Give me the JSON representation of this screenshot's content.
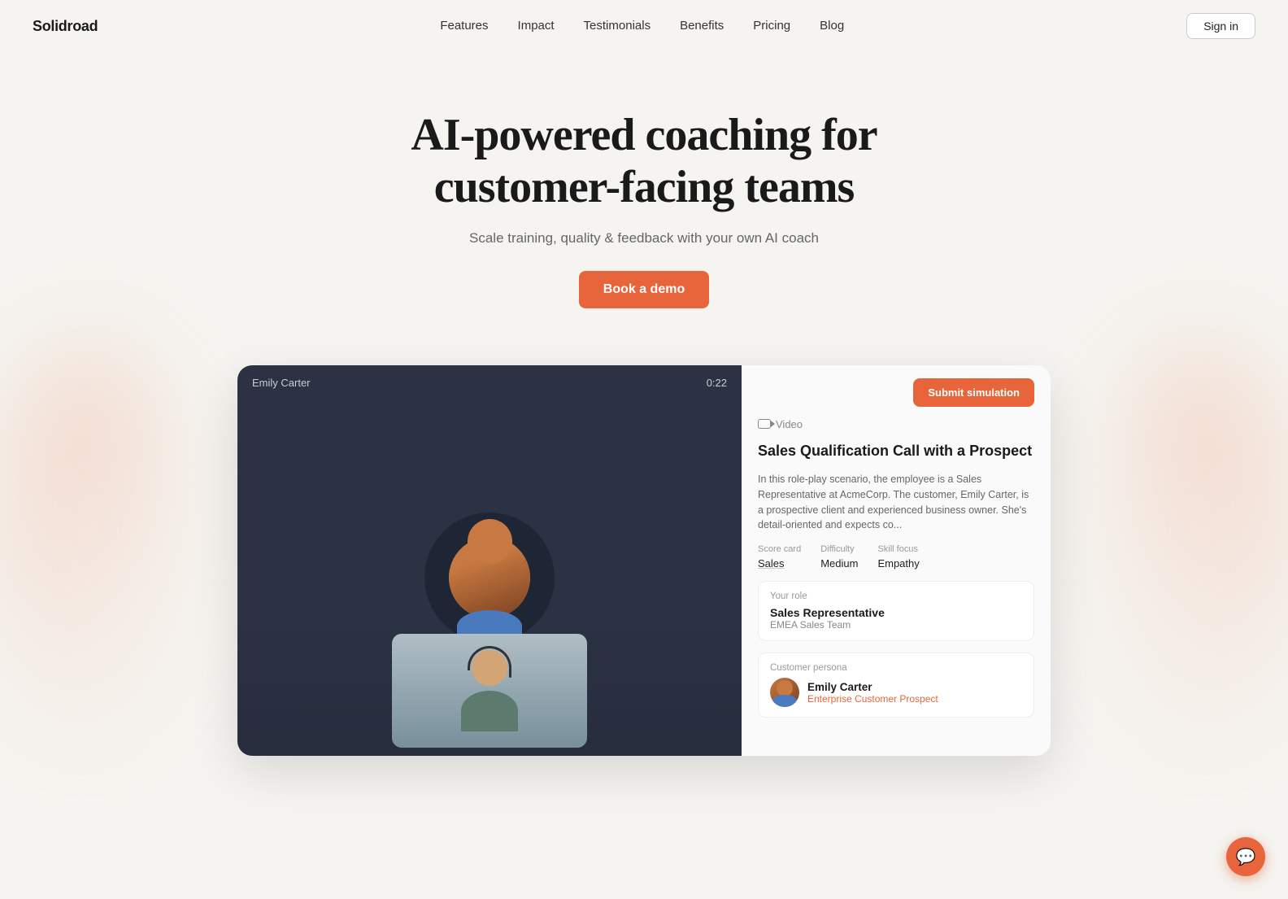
{
  "brand": {
    "name": "Solidroad"
  },
  "nav": {
    "links": [
      {
        "label": "Features",
        "href": "#"
      },
      {
        "label": "Impact",
        "href": "#"
      },
      {
        "label": "Testimonials",
        "href": "#"
      },
      {
        "label": "Benefits",
        "href": "#"
      },
      {
        "label": "Pricing",
        "href": "#"
      },
      {
        "label": "Blog",
        "href": "#"
      }
    ],
    "signin_label": "Sign in"
  },
  "hero": {
    "heading_line1": "AI-powered coaching for",
    "heading_line2": "customer-facing teams",
    "subtext": "Scale training, quality & feedback with your own AI coach",
    "cta_label": "Book a demo"
  },
  "demo": {
    "submit_label": "Submit simulation",
    "video_label": "Video",
    "scenario_title": "Sales Qualification Call with a Prospect",
    "scenario_description": "In this role-play scenario, the employee is a Sales Representative at AcmeCorp. The customer, Emily Carter, is a prospective client and experienced business owner. She's detail-oriented and expects co...",
    "scorecard_label": "Score card",
    "scorecard_value": "Sales",
    "difficulty_label": "Difficulty",
    "difficulty_value": "Medium",
    "skill_label": "Skill focus",
    "skill_value": "Empathy",
    "your_role_label": "Your role",
    "your_role_title": "Sales Representative",
    "your_role_team": "EMEA Sales Team",
    "customer_persona_label": "Customer persona",
    "customer_name": "Emily Carter",
    "customer_role": "Enterprise Customer Prospect",
    "video_name_label": "Emily Carter",
    "video_timer": "0:22"
  },
  "chat_icon": "💬"
}
